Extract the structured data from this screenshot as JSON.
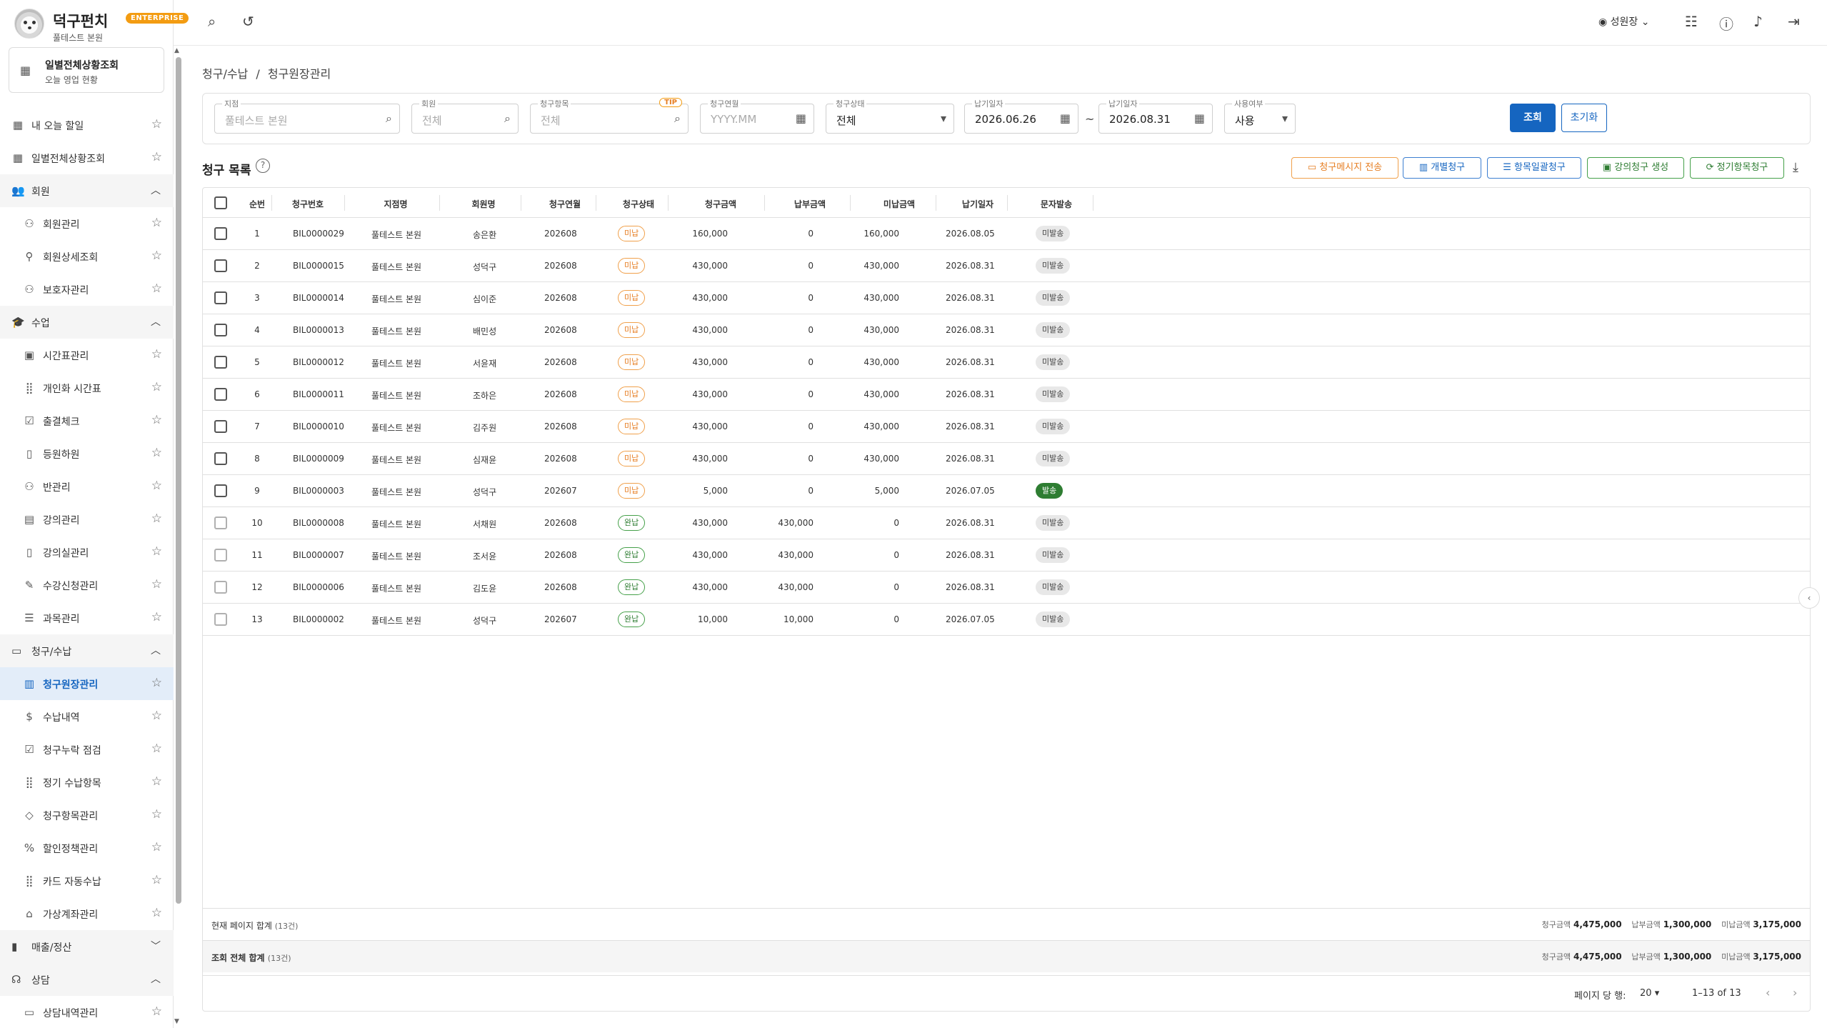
{
  "brand": {
    "name": "덕구펀치",
    "badge": "ENTERPRISE",
    "branch": "풀테스트 본원"
  },
  "pinned": {
    "title": "일별전체상황조회",
    "subtitle": "오늘 영업 현황"
  },
  "sidebar": {
    "items": [
      {
        "type": "item",
        "label": "내 오늘 할일",
        "icon": "dashboard-icon",
        "glyph": "▦"
      },
      {
        "type": "item",
        "label": "일별전체상황조회",
        "icon": "dashboard-icon",
        "glyph": "▦"
      },
      {
        "type": "group",
        "label": "회원",
        "icon": "members-icon",
        "glyph": "👥",
        "expanded": true
      },
      {
        "type": "sub",
        "label": "회원관리",
        "icon": "person-icon",
        "glyph": "⚇"
      },
      {
        "type": "sub",
        "label": "회원상세조회",
        "icon": "person-search-icon",
        "glyph": "⚲"
      },
      {
        "type": "sub",
        "label": "보호자관리",
        "icon": "guardian-icon",
        "glyph": "⚇"
      },
      {
        "type": "group",
        "label": "수업",
        "icon": "school-icon",
        "glyph": "🎓",
        "expanded": true
      },
      {
        "type": "sub",
        "label": "시간표관리",
        "icon": "calendar-icon",
        "glyph": "▣"
      },
      {
        "type": "sub",
        "label": "개인화 시간표",
        "icon": "grid-icon",
        "glyph": "⣿"
      },
      {
        "type": "sub",
        "label": "출결체크",
        "icon": "check-list-icon",
        "glyph": "☑"
      },
      {
        "type": "sub",
        "label": "등원하원",
        "icon": "door-icon",
        "glyph": "▯"
      },
      {
        "type": "sub",
        "label": "반관리",
        "icon": "group-icon",
        "glyph": "⚇"
      },
      {
        "type": "sub",
        "label": "강의관리",
        "icon": "book-icon",
        "glyph": "▤"
      },
      {
        "type": "sub",
        "label": "강의실관리",
        "icon": "room-icon",
        "glyph": "▯"
      },
      {
        "type": "sub",
        "label": "수강신청관리",
        "icon": "person-edit-icon",
        "glyph": "✎"
      },
      {
        "type": "sub",
        "label": "과목관리",
        "icon": "list-icon",
        "glyph": "☰"
      },
      {
        "type": "group",
        "label": "청구/수납",
        "icon": "billing-icon",
        "glyph": "▭",
        "expanded": true
      },
      {
        "type": "sub",
        "label": "청구원장관리",
        "icon": "receipt-icon",
        "glyph": "▥",
        "active": true
      },
      {
        "type": "sub",
        "label": "수납내역",
        "icon": "dollar-icon",
        "glyph": "$"
      },
      {
        "type": "sub",
        "label": "청구누락 점검",
        "icon": "checklist-icon",
        "glyph": "☑"
      },
      {
        "type": "sub",
        "label": "정기 수납항목",
        "icon": "grid-icon",
        "glyph": "⣿"
      },
      {
        "type": "sub",
        "label": "청구항목관리",
        "icon": "tag-icon",
        "glyph": "◇"
      },
      {
        "type": "sub",
        "label": "할인정책관리",
        "icon": "percent-icon",
        "glyph": "%"
      },
      {
        "type": "sub",
        "label": "카드 자동수납",
        "icon": "grid-icon",
        "glyph": "⣿"
      },
      {
        "type": "sub",
        "label": "가상계좌관리",
        "icon": "bank-icon",
        "glyph": "⌂"
      },
      {
        "type": "group",
        "label": "매출/정산",
        "icon": "chart-icon",
        "glyph": "▮",
        "expanded": false
      },
      {
        "type": "group",
        "label": "상담",
        "icon": "headset-icon",
        "glyph": "☊",
        "expanded": true
      },
      {
        "type": "sub",
        "label": "상담내역관리",
        "icon": "chat-icon",
        "glyph": "▭"
      }
    ]
  },
  "topbar": {
    "user": "성원장",
    "icons": [
      "search-icon",
      "history-icon",
      "settings-sliders-icon",
      "help-icon",
      "bell-icon",
      "logout-icon"
    ]
  },
  "breadcrumb": {
    "section": "청구/수납",
    "separator": "/",
    "page": "청구원장관리"
  },
  "filters": {
    "branch": {
      "label": "지점",
      "placeholder": "풀테스트 본원"
    },
    "member": {
      "label": "회원",
      "placeholder": "전체"
    },
    "item": {
      "label": "청구항목",
      "placeholder": "전체",
      "tip": "TIP"
    },
    "month": {
      "label": "청구연월",
      "placeholder": "YYYY.MM"
    },
    "status": {
      "label": "청구상태",
      "value": "전체"
    },
    "due_from": {
      "label": "납기일자",
      "value": "2026.06.26"
    },
    "tilde": "~",
    "due_to": {
      "label": "납기일자",
      "value": "2026.08.31"
    },
    "use": {
      "label": "사용여부",
      "value": "사용"
    },
    "search_button": "조회",
    "reset_button": "초기화"
  },
  "list": {
    "title": "청구 목록",
    "actions": {
      "send_message": "청구메시지 전송",
      "individual": "개별청구",
      "bulk_item": "항목일괄청구",
      "lecture_create": "강의청구 생성",
      "regular_item": "정기항목청구"
    }
  },
  "table": {
    "columns": [
      "순번",
      "청구번호",
      "지점명",
      "회원명",
      "청구연월",
      "청구상태",
      "청구금액",
      "납부금액",
      "미납금액",
      "납기일자",
      "문자발송"
    ],
    "rows": [
      {
        "no": "1",
        "bill": "BIL0000029",
        "branch": "풀테스트 본원",
        "member": "송은환",
        "month": "202608",
        "status": "미납",
        "amount": "160,000",
        "paid": "0",
        "unpaid": "160,000",
        "due": "2026.08.05",
        "sms": "미발송"
      },
      {
        "no": "2",
        "bill": "BIL0000015",
        "branch": "풀테스트 본원",
        "member": "성덕구",
        "month": "202608",
        "status": "미납",
        "amount": "430,000",
        "paid": "0",
        "unpaid": "430,000",
        "due": "2026.08.31",
        "sms": "미발송"
      },
      {
        "no": "3",
        "bill": "BIL0000014",
        "branch": "풀테스트 본원",
        "member": "심이준",
        "month": "202608",
        "status": "미납",
        "amount": "430,000",
        "paid": "0",
        "unpaid": "430,000",
        "due": "2026.08.31",
        "sms": "미발송"
      },
      {
        "no": "4",
        "bill": "BIL0000013",
        "branch": "풀테스트 본원",
        "member": "배민성",
        "month": "202608",
        "status": "미납",
        "amount": "430,000",
        "paid": "0",
        "unpaid": "430,000",
        "due": "2026.08.31",
        "sms": "미발송"
      },
      {
        "no": "5",
        "bill": "BIL0000012",
        "branch": "풀테스트 본원",
        "member": "서윤재",
        "month": "202608",
        "status": "미납",
        "amount": "430,000",
        "paid": "0",
        "unpaid": "430,000",
        "due": "2026.08.31",
        "sms": "미발송"
      },
      {
        "no": "6",
        "bill": "BIL0000011",
        "branch": "풀테스트 본원",
        "member": "조하은",
        "month": "202608",
        "status": "미납",
        "amount": "430,000",
        "paid": "0",
        "unpaid": "430,000",
        "due": "2026.08.31",
        "sms": "미발송"
      },
      {
        "no": "7",
        "bill": "BIL0000010",
        "branch": "풀테스트 본원",
        "member": "김주원",
        "month": "202608",
        "status": "미납",
        "amount": "430,000",
        "paid": "0",
        "unpaid": "430,000",
        "due": "2026.08.31",
        "sms": "미발송"
      },
      {
        "no": "8",
        "bill": "BIL0000009",
        "branch": "풀테스트 본원",
        "member": "심재윤",
        "month": "202608",
        "status": "미납",
        "amount": "430,000",
        "paid": "0",
        "unpaid": "430,000",
        "due": "2026.08.31",
        "sms": "미발송"
      },
      {
        "no": "9",
        "bill": "BIL0000003",
        "branch": "풀테스트 본원",
        "member": "성덕구",
        "month": "202607",
        "status": "미납",
        "amount": "5,000",
        "paid": "0",
        "unpaid": "5,000",
        "due": "2026.07.05",
        "sms": "발송"
      },
      {
        "no": "10",
        "bill": "BIL0000008",
        "branch": "풀테스트 본원",
        "member": "서채원",
        "month": "202608",
        "status": "완납",
        "amount": "430,000",
        "paid": "430,000",
        "unpaid": "0",
        "due": "2026.08.31",
        "sms": "미발송"
      },
      {
        "no": "11",
        "bill": "BIL0000007",
        "branch": "풀테스트 본원",
        "member": "조서윤",
        "month": "202608",
        "status": "완납",
        "amount": "430,000",
        "paid": "430,000",
        "unpaid": "0",
        "due": "2026.08.31",
        "sms": "미발송"
      },
      {
        "no": "12",
        "bill": "BIL0000006",
        "branch": "풀테스트 본원",
        "member": "김도윤",
        "month": "202608",
        "status": "완납",
        "amount": "430,000",
        "paid": "430,000",
        "unpaid": "0",
        "due": "2026.08.31",
        "sms": "미발송"
      },
      {
        "no": "13",
        "bill": "BIL0000002",
        "branch": "풀테스트 본원",
        "member": "성덕구",
        "month": "202607",
        "status": "완납",
        "amount": "10,000",
        "paid": "10,000",
        "unpaid": "0",
        "due": "2026.07.05",
        "sms": "미발송"
      }
    ]
  },
  "summary": {
    "page": {
      "label": "현재 페이지 합계",
      "count": "(13건)",
      "bill_label": "청구금액",
      "bill": "4,475,000",
      "paid_label": "납부금액",
      "paid": "1,300,000",
      "unpaid_label": "미납금액",
      "unpaid": "3,175,000"
    },
    "total": {
      "label": "조회 전체 합계",
      "count": "(13건)",
      "bill_label": "청구금액",
      "bill": "4,475,000",
      "paid_label": "납부금액",
      "paid": "1,300,000",
      "unpaid_label": "미납금액",
      "unpaid": "3,175,000"
    }
  },
  "pager": {
    "rows_label": "페이지 당 행:",
    "rows_per_page": "20",
    "range": "1–13 of 13"
  },
  "colors": {
    "primary": "#1565c0",
    "unpaid": "#e67e22",
    "paid": "#2e7d32",
    "enterprise_badge": "#f39c12"
  }
}
